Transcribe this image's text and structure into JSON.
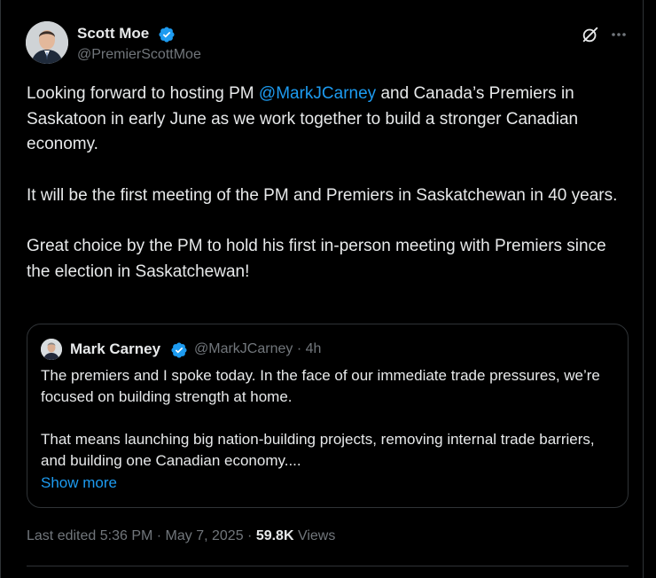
{
  "author": {
    "name": "Scott Moe",
    "handle": "@PremierScottMoe",
    "verified": true
  },
  "post": {
    "text_part1": "Looking forward to hosting PM ",
    "mention": "@MarkJCarney",
    "text_part2": " and Canada’s Premiers in Saskatoon in early June as we work together to build a stronger Canadian economy.\n\nIt will be the first meeting of the PM and Premiers in Saskatchewan in 40 years.\n\nGreat choice by the PM to hold his first in-person meeting with Premiers since the election in Saskatchewan!"
  },
  "quoted_post": {
    "name": "Mark Carney",
    "handle_time": "@MarkJCarney · 4h",
    "text": "The premiers and I spoke today. In the face of our immediate trade pressures, we’re focused on building strength at home.\n\nThat means launching big nation-building projects, removing internal trade barriers, and building one Canadian economy....",
    "show_more": "Show more"
  },
  "meta": {
    "edited": "Last edited 5:36 PM · May 7, 2025 · ",
    "views_count": "59.8K",
    "views_label": " Views"
  },
  "colors": {
    "background": "#000000",
    "text": "#e7e9ea",
    "secondary": "#71767b",
    "accent": "#1d9bf0",
    "border": "#2f3336"
  },
  "icons": [
    "verified-badge-icon",
    "grok-icon",
    "more-options-icon"
  ]
}
